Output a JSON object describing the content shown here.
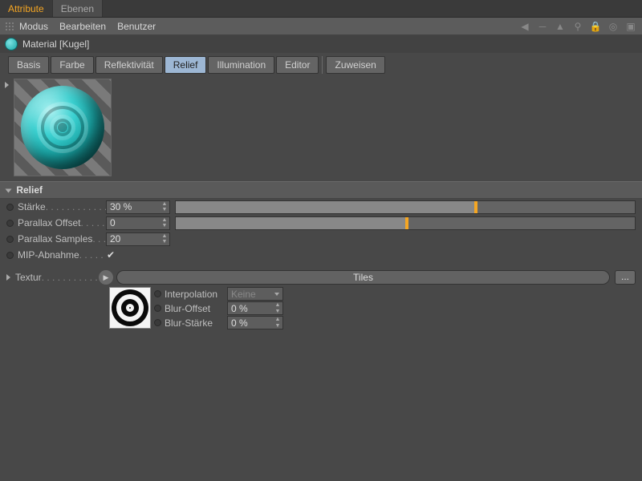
{
  "top_tabs": {
    "attribute": "Attribute",
    "ebenen": "Ebenen"
  },
  "menu": {
    "modus": "Modus",
    "bearbeiten": "Bearbeiten",
    "benutzer": "Benutzer"
  },
  "toolbar_icons": {
    "prev": "◀",
    "divider": "─",
    "up": "▲",
    "search": "⚲",
    "lock": "🔒",
    "target": "◎",
    "new": "▣"
  },
  "object": {
    "title": "Material [Kugel]"
  },
  "channel_tabs": {
    "basis": "Basis",
    "farbe": "Farbe",
    "reflekt": "Reflektivität",
    "relief": "Relief",
    "illum": "Illumination",
    "editor": "Editor",
    "zuweisen": "Zuweisen"
  },
  "section": {
    "relief": "Relief"
  },
  "params": {
    "staerke": {
      "label": "Stärke",
      "value": "30 %",
      "slider_fill_pct": 65,
      "handle_pct": 65
    },
    "parallax_offset": {
      "label": "Parallax Offset",
      "value": "0",
      "slider_fill_pct": 50,
      "handle_pct": 50
    },
    "parallax_samples": {
      "label": "Parallax Samples",
      "value": "20"
    },
    "mip": {
      "label": "MIP-Abnahme",
      "checked": true
    },
    "textur": {
      "label": "Textur",
      "shader": "Tiles",
      "dots": "..."
    },
    "interp": {
      "label": "Interpolation",
      "value": "Keine"
    },
    "blur_offset": {
      "label": "Blur-Offset",
      "value": "0 %"
    },
    "blur_staerke": {
      "label": "Blur-Stärke",
      "value": "0 %"
    }
  }
}
